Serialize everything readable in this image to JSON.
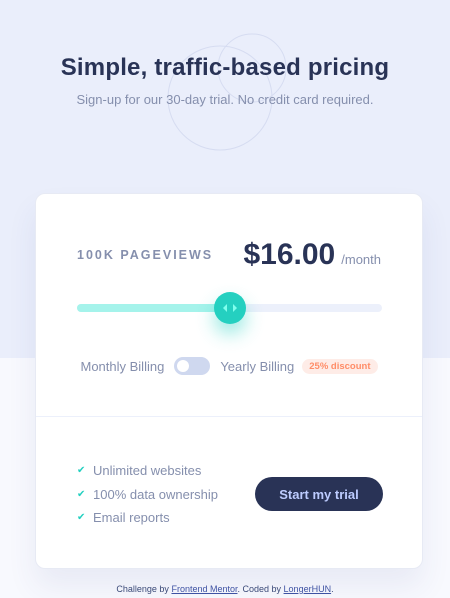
{
  "header": {
    "title": "Simple, traffic-based pricing",
    "subtitle": "Sign-up for our 30-day trial. No credit card required."
  },
  "pricing": {
    "pageviews": "100K PAGEVIEWS",
    "price": "$16.00",
    "period": "/month",
    "slider_percent": 50
  },
  "billing": {
    "monthly_label": "Monthly Billing",
    "yearly_label": "Yearly Billing",
    "discount": "25% discount",
    "yearly_selected": false
  },
  "features": [
    "Unlimited websites",
    "100% data ownership",
    "Email reports"
  ],
  "cta": {
    "label": "Start my trial"
  },
  "footer": {
    "prefix": "Challenge by",
    "link1": "Frontend Mentor",
    "middle": ". Coded by",
    "link2": "LongerHUN",
    "suffix": "."
  },
  "colors": {
    "accent": "#24d0c0",
    "slider_fill": "#a5f3eb",
    "dark": "#293356",
    "discount": "#ff8d68"
  },
  "icons": {
    "feature": "check-icon",
    "thumb": "slider-arrows-icon"
  }
}
